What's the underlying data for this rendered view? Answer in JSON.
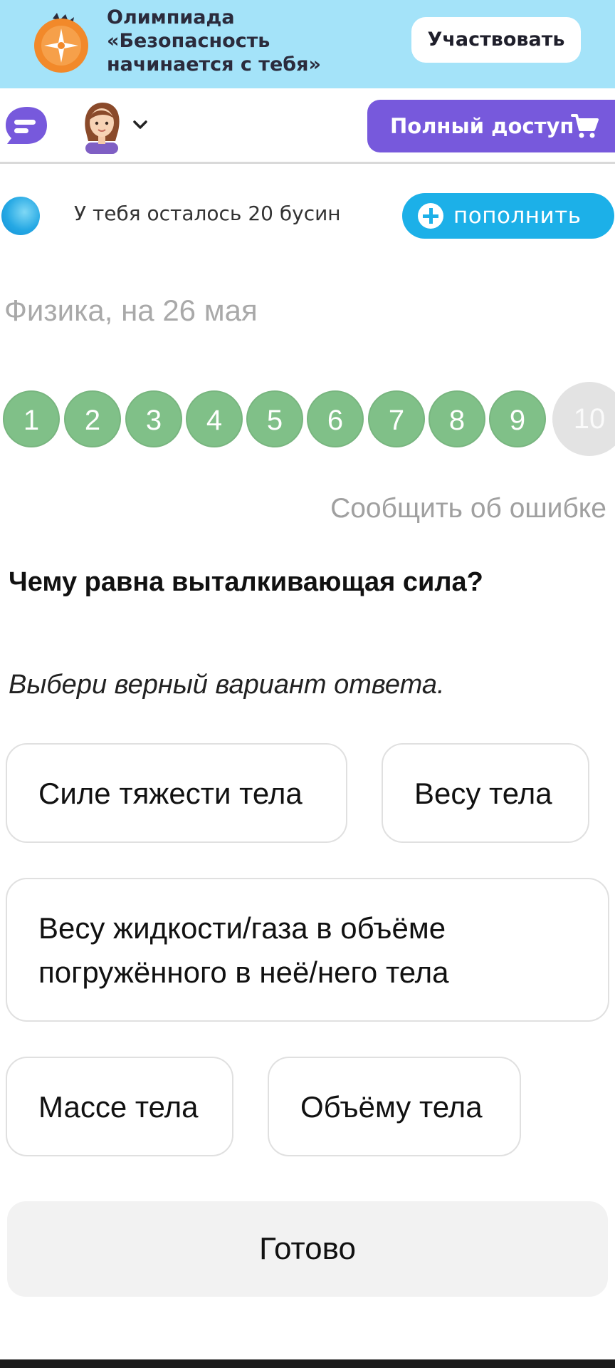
{
  "banner": {
    "title_lines": [
      "Олимпиада",
      "«Безопасность",
      "начинается с тебя»"
    ],
    "participate_label": "Участвовать",
    "background": "#a4e3f9"
  },
  "nav": {
    "chat_icon": "chat-bubble-icon",
    "avatar_icon": "user-avatar",
    "full_access_label": "Полный доступ",
    "accent": "#7759dc"
  },
  "beads": {
    "text": "У тебя осталось 20 бусин",
    "refill_label": "пополнить",
    "accent": "#1cb0e8"
  },
  "subject": "Физика, на 26 мая",
  "questions": {
    "numbers": [
      "1",
      "2",
      "3",
      "4",
      "5",
      "6",
      "7",
      "8",
      "9",
      "10"
    ],
    "answered_color": "#80c088",
    "current": "10"
  },
  "report_label": "Сообщить об ошибке",
  "question_text": "Чему равна выталкивающая сила?",
  "instruction": "Выбери верный вариант ответа.",
  "options": [
    {
      "lines": [
        "Силе тяжести тела"
      ]
    },
    {
      "lines": [
        "Весу тела"
      ]
    },
    {
      "lines": [
        "Весу жидкости/газа в объёме",
        "погружённого в неё/него тела"
      ]
    },
    {
      "lines": [
        "Массе тела"
      ]
    },
    {
      "lines": [
        "Объёму тела"
      ]
    }
  ],
  "done_label": "Готово"
}
